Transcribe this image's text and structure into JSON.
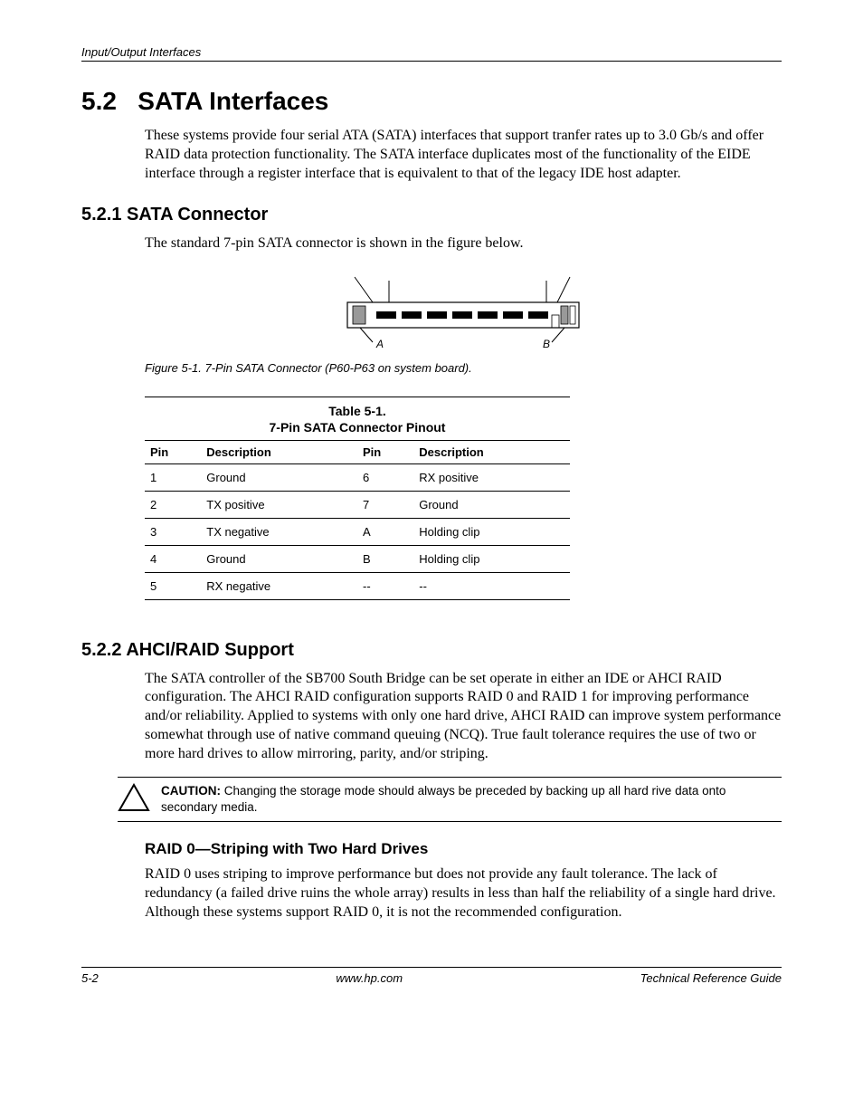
{
  "header": {
    "chapter": "Input/Output Interfaces"
  },
  "section52": {
    "number": "5.2",
    "title": "SATA Interfaces",
    "para1": "These systems provide four serial ATA (SATA) interfaces that support tranfer rates up to 3.0 Gb/s and offer RAID data protection functionality. The SATA interface duplicates most of the functionality of the EIDE interface through a register interface that is equivalent to that of the legacy IDE host adapter."
  },
  "section521": {
    "number": "5.2.1",
    "title": "SATA Connector",
    "para1": "The standard 7-pin SATA connector is shown in the figure below.",
    "figure": {
      "label_a": "A",
      "label_b": "B",
      "caption": "Figure 5-1.   7-Pin SATA Connector (P60-P63 on system board)."
    },
    "table": {
      "number": "Table 5-1.",
      "title": "7-Pin SATA Connector Pinout",
      "headers": {
        "pin": "Pin",
        "desc": "Description"
      },
      "rows": [
        {
          "p1": "1",
          "d1": "Ground",
          "p2": "6",
          "d2": "RX positive"
        },
        {
          "p1": "2",
          "d1": "TX positive",
          "p2": "7",
          "d2": "Ground"
        },
        {
          "p1": "3",
          "d1": "TX negative",
          "p2": "A",
          "d2": "Holding clip"
        },
        {
          "p1": "4",
          "d1": "Ground",
          "p2": "B",
          "d2": "Holding clip"
        },
        {
          "p1": "5",
          "d1": "RX negative",
          "p2": "--",
          "d2": "--"
        }
      ]
    }
  },
  "section522": {
    "number": "5.2.2",
    "title": "AHCI/RAID Support",
    "para1": "The SATA controller of the SB700 South Bridge can be set operate in either an IDE or AHCI RAID configuration. The AHCI RAID configuration supports RAID 0 and RAID 1 for improving performance and/or reliability. Applied to systems with only one hard drive, AHCI RAID can improve system performance somewhat through use of native command queuing (NCQ). True fault tolerance requires the use of two or more hard drives to allow mirroring, parity, and/or striping.",
    "caution_label": "CAUTION:",
    "caution_text": " Changing the storage mode should always be preceded by backing up all hard rive data onto secondary media.",
    "raid0_title": "RAID 0—Striping with Two Hard Drives",
    "raid0_para": "RAID 0 uses striping to improve performance but does not provide any fault tolerance. The lack of redundancy (a failed drive ruins the whole array) results in less than half the reliability of a single hard drive. Although these systems support RAID 0, it is not the recommended configuration."
  },
  "footer": {
    "page": "5-2",
    "url": "www.hp.com",
    "doc": "Technical Reference Guide"
  }
}
